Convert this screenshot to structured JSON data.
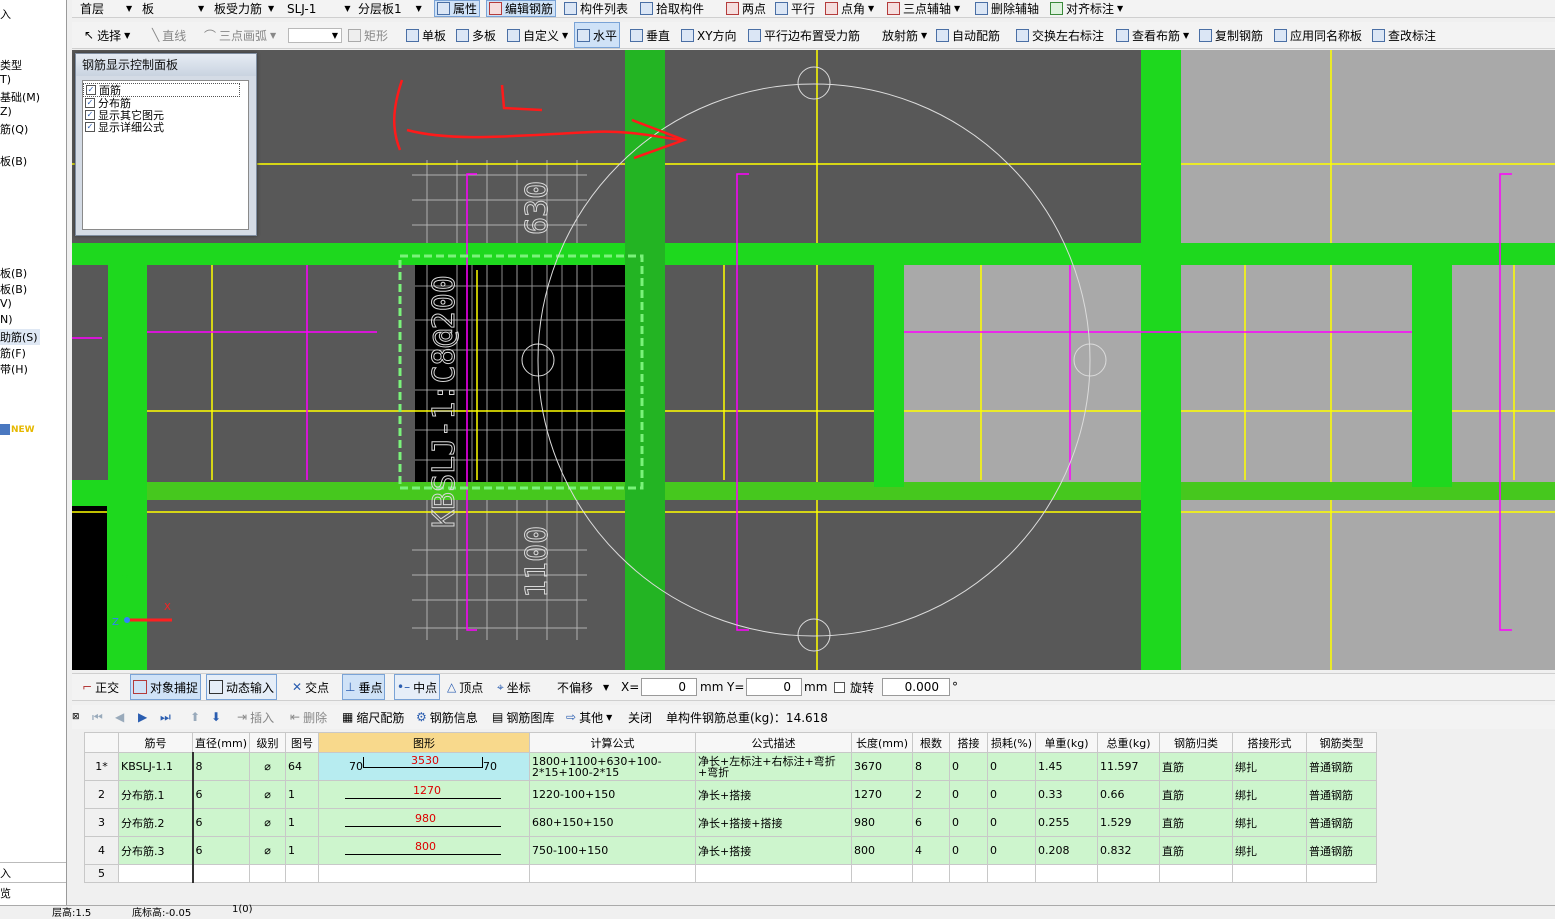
{
  "toolbar1": {
    "floor": "首层",
    "category": "板",
    "subcategory": "板受力筋",
    "component": "SLJ-1",
    "layer": "分层板1",
    "property": "属性",
    "edit_rebar": "编辑钢筋",
    "component_list": "构件列表",
    "pick_component": "拾取构件",
    "two_points": "两点",
    "parallel": "平行",
    "point_angle": "点角",
    "three_point_axis": "三点辅轴",
    "delete_axis": "删除辅轴",
    "align_label": "对齐标注"
  },
  "toolbar2": {
    "select": "选择",
    "line": "直线",
    "arc": "三点画弧",
    "rect": "矩形",
    "single_slab": "单板",
    "multi_slab": "多板",
    "custom": "自定义",
    "horizontal": "水平",
    "vertical": "垂直",
    "xy_dir": "XY方向",
    "parallel_edge": "平行边布置受力筋",
    "radial": "放射筋",
    "auto_config": "自动配筋",
    "swap_labels": "交换左右标注",
    "view_layout": "查看布筋",
    "copy_rebar": "复制钢筋",
    "apply_same": "应用同名称板",
    "modify_label": "查改标注"
  },
  "left_panel": {
    "items": [
      "入",
      "类型",
      "T)",
      "基础(M)",
      "Z)",
      "筋(Q)",
      "板(B)",
      "板(B)",
      "板(B)",
      "V)",
      "N)",
      "助筋(S)",
      "筋(F)",
      "带(H)",
      "NEW",
      "入",
      "览"
    ]
  },
  "control_panel": {
    "title": "钢筋显示控制面板",
    "options": [
      "面筋",
      "分布筋",
      "显示其它图元",
      "显示详细公式"
    ]
  },
  "canvas": {
    "rebar_label": "KBSLJ-1:C8@200",
    "num_630": "630",
    "num_1100": "1100",
    "axis_x": "X",
    "axis_y": "Y",
    "axis_z": "Z"
  },
  "snap_bar": {
    "ortho": "正交",
    "object_snap": "对象捕捉",
    "dynamic_input": "动态输入",
    "intersection": "交点",
    "perpendicular": "垂点",
    "midpoint": "中点",
    "vertex": "顶点",
    "coordinate": "坐标",
    "offset": "不偏移",
    "x_label": "X=",
    "x_value": "0",
    "unit": "mm",
    "y_label": "Y=",
    "y_value": "0",
    "rotate": "旋转",
    "rotate_value": "0.000",
    "degree": "°"
  },
  "rebar_bar": {
    "insert": "插入",
    "delete": "删除",
    "scale": "缩尺配筋",
    "info": "钢筋信息",
    "library": "钢筋图库",
    "other": "其他",
    "close": "关闭",
    "total_label": "单构件钢筋总重(kg)：14.618"
  },
  "table": {
    "headers": [
      "筋号",
      "直径(mm)",
      "级别",
      "图号",
      "图形",
      "计算公式",
      "公式描述",
      "长度(mm)",
      "根数",
      "搭接",
      "损耗(%)",
      "单重(kg)",
      "总重(kg)",
      "钢筋归类",
      "搭接形式",
      "钢筋类型"
    ],
    "rows": [
      {
        "no": "1*",
        "name": "KBSLJ-1.1",
        "dia": "8",
        "grade": "⌀",
        "fig": "64",
        "shape_left": "70",
        "shape_mid": "3530",
        "shape_right": "70",
        "formula": "1800+1100+630+100-2*15+100-2*15",
        "desc": "净长+左标注+右标注+弯折+弯折",
        "length": "3670",
        "count": "8",
        "lap": "0",
        "loss": "0",
        "unit_w": "1.45",
        "total_w": "11.597",
        "cat": "直筋",
        "lap_type": "绑扎",
        "type": "普通钢筋"
      },
      {
        "no": "2",
        "name": "分布筋.1",
        "dia": "6",
        "grade": "⌀",
        "fig": "1",
        "shape_mid": "1270",
        "formula": "1220-100+150",
        "desc": "净长+搭接",
        "length": "1270",
        "count": "2",
        "lap": "0",
        "loss": "0",
        "unit_w": "0.33",
        "total_w": "0.66",
        "cat": "直筋",
        "lap_type": "绑扎",
        "type": "普通钢筋"
      },
      {
        "no": "3",
        "name": "分布筋.2",
        "dia": "6",
        "grade": "⌀",
        "fig": "1",
        "shape_mid": "980",
        "formula": "680+150+150",
        "desc": "净长+搭接+搭接",
        "length": "980",
        "count": "6",
        "lap": "0",
        "loss": "0",
        "unit_w": "0.255",
        "total_w": "1.529",
        "cat": "直筋",
        "lap_type": "绑扎",
        "type": "普通钢筋"
      },
      {
        "no": "4",
        "name": "分布筋.3",
        "dia": "6",
        "grade": "⌀",
        "fig": "1",
        "shape_mid": "800",
        "formula": "750-100+150",
        "desc": "净长+搭接",
        "length": "800",
        "count": "4",
        "lap": "0",
        "loss": "0",
        "unit_w": "0.208",
        "total_w": "0.832",
        "cat": "直筋",
        "lap_type": "绑扎",
        "type": "普通钢筋"
      }
    ],
    "empty_row_no": "5"
  },
  "status": {
    "floor_height": "层高:1.5",
    "base_height": "底标高:-0.05",
    "count": "1(0)"
  },
  "colors": {
    "canvas_bg": "#585858",
    "beam_green": "#1ed81e",
    "grid_yellow": "#ffff00",
    "rebar_magenta": "#ff00ff",
    "annotation_red": "#ff0000",
    "row_green": "#cdf5cd"
  }
}
